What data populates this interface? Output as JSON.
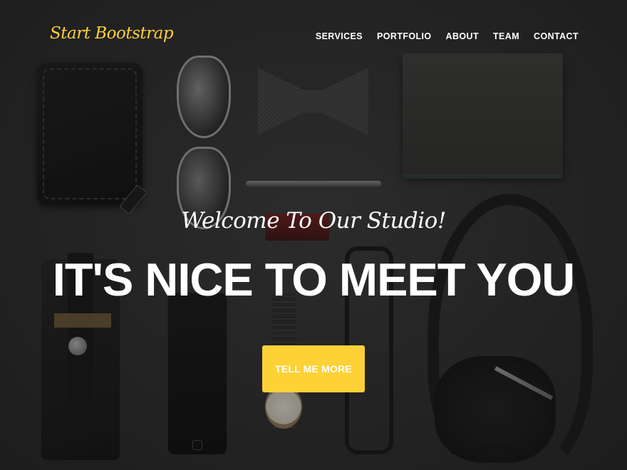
{
  "navbar": {
    "brand": "Start Bootstrap",
    "links": [
      "Services",
      "Portfolio",
      "About",
      "Team",
      "Contact"
    ]
  },
  "hero": {
    "subheading": "Welcome To Our Studio!",
    "heading": "IT'S NICE TO MEET YOU",
    "button": "Tell Me More"
  },
  "colors": {
    "accent": "#fed136",
    "text": "#ffffff",
    "background": "#2c2c2c"
  }
}
